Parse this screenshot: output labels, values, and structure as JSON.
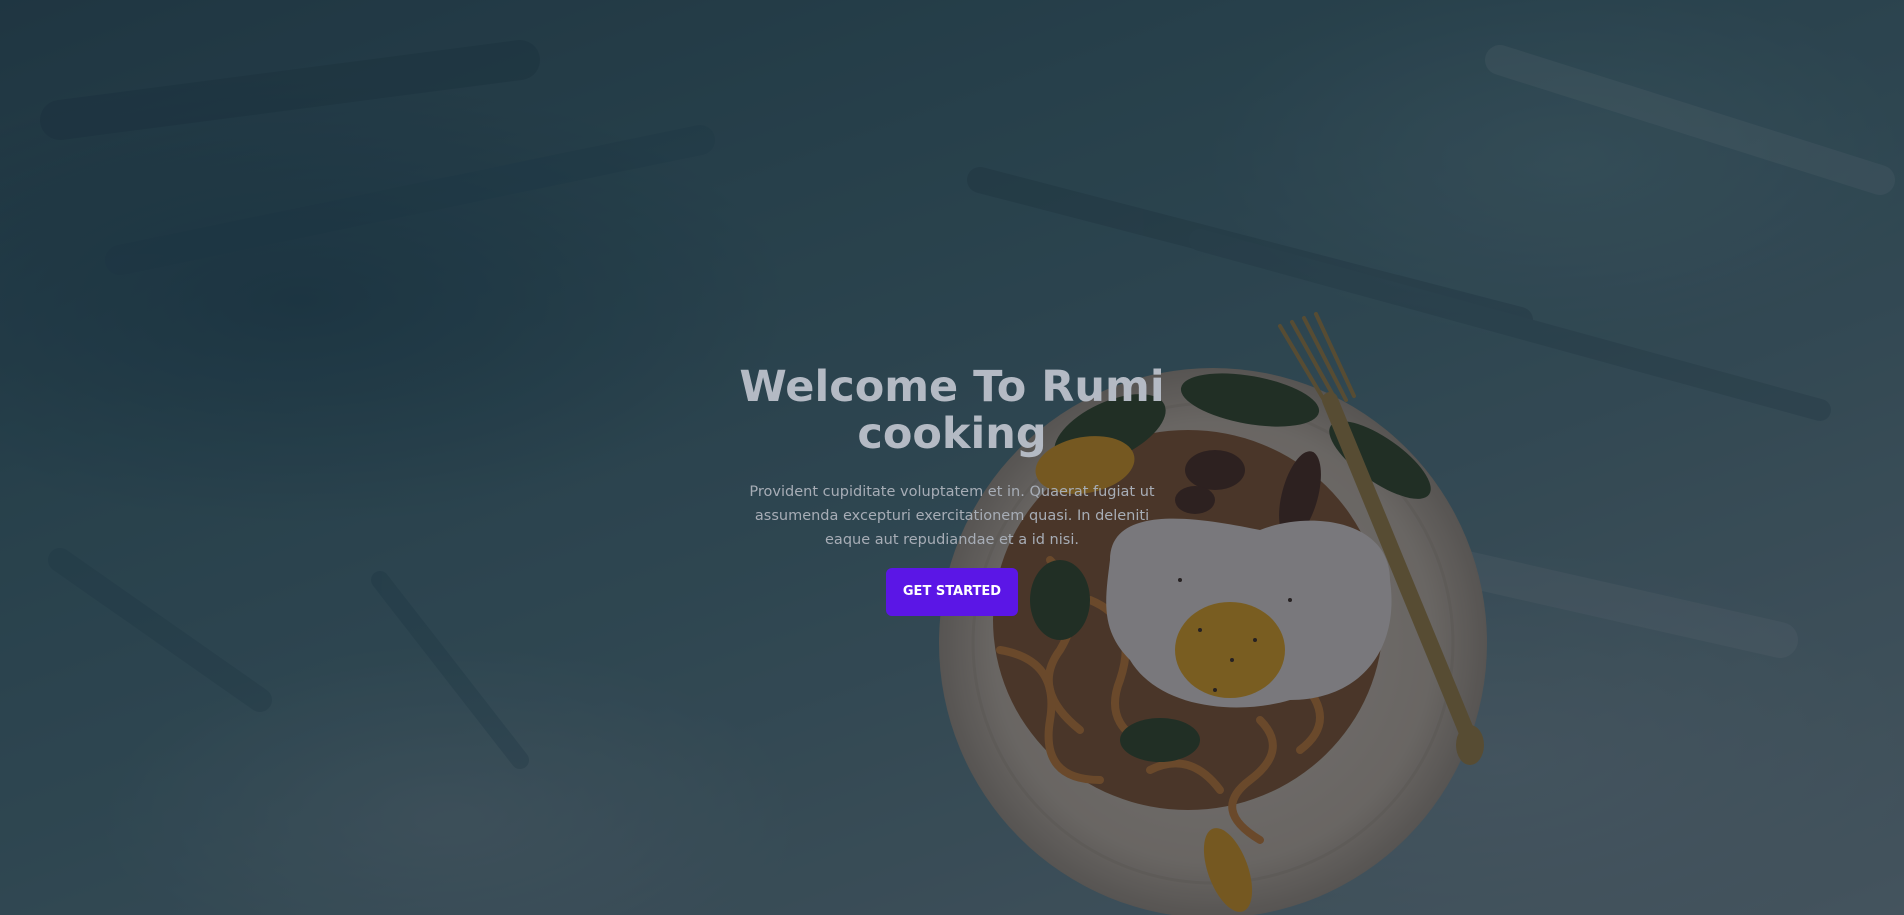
{
  "hero": {
    "title": "Welcome To Rumi cooking",
    "description": "Provident cupiditate voluptatem et in. Quaerat fugiat ut assumenda excepturi exercitationem quasi. In deleniti eaque aut repudiandae et a id nisi.",
    "cta_label": "GET STARTED",
    "accent_color": "#5b16e6",
    "background_image": "food-plate-photo"
  }
}
